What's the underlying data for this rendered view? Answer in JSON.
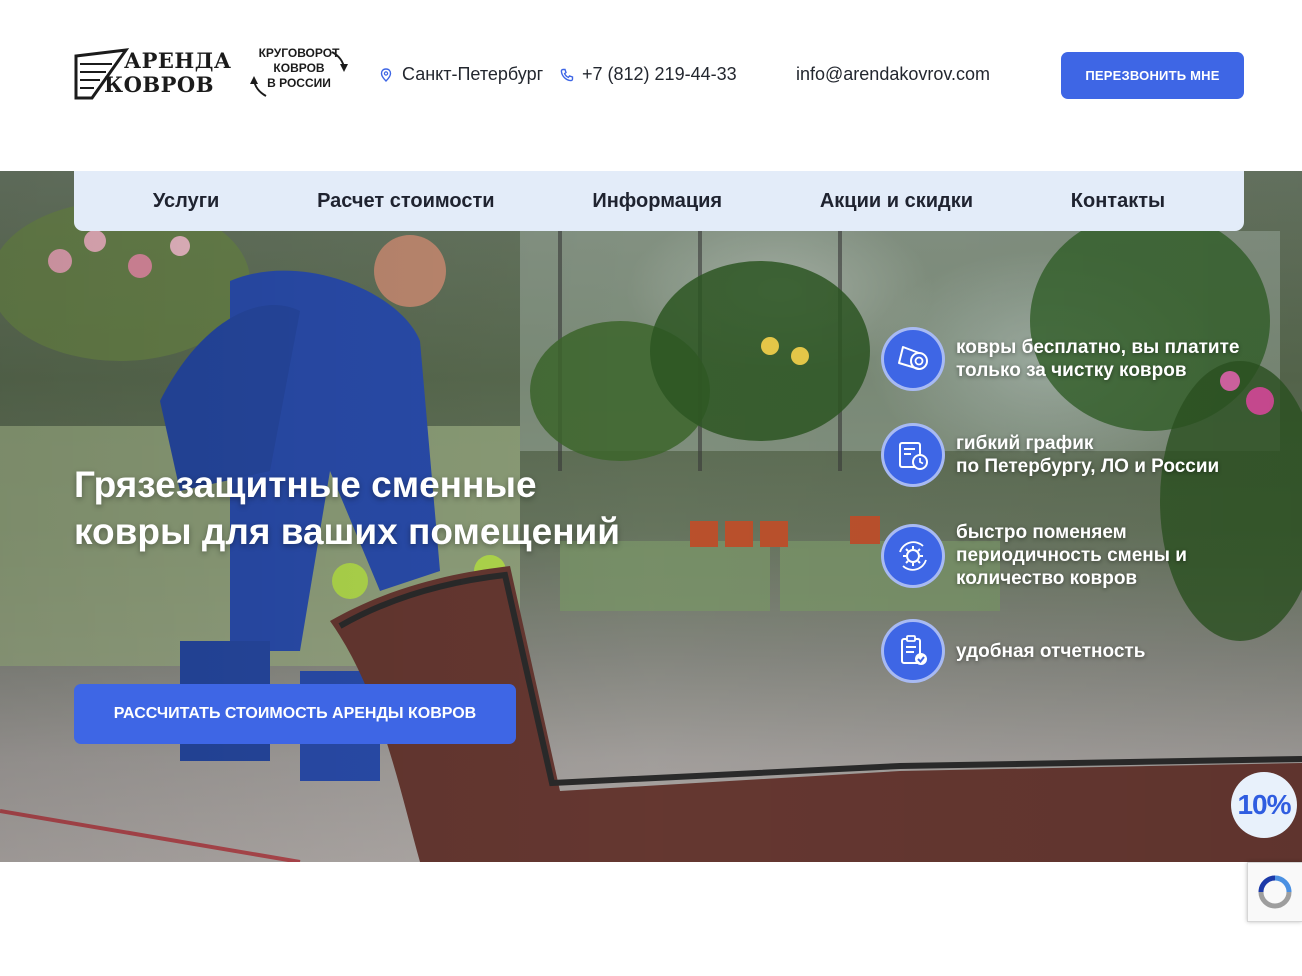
{
  "logo": {
    "line1": "АРЕНДА",
    "line2": "КОВРОВ"
  },
  "slogan": {
    "line1": "КРУГОВОРОТ",
    "line2": "КОВРОВ",
    "line3": "В РОССИИ"
  },
  "header": {
    "city": "Санкт-Петербург",
    "phone": "+7 (812) 219-44-33",
    "email": "info@arendakovrov.com",
    "callback_label": "ПЕРЕЗВОНИТЬ МНЕ"
  },
  "nav": {
    "items": [
      {
        "label": "Услуги"
      },
      {
        "label": "Расчет стоимости"
      },
      {
        "label": "Информация"
      },
      {
        "label": "Акции и скидки"
      },
      {
        "label": "Контакты"
      }
    ]
  },
  "hero": {
    "title_line1": "Грязезащитные сменные",
    "title_line2": "ковры для ваших помещений",
    "cta_label": "РАССЧИТАТЬ СТОИМОСТЬ АРЕНДЫ КОВРОВ"
  },
  "features": [
    {
      "icon": "carpet-roll-icon",
      "lines": [
        "ковры бесплатно, вы платите",
        "только за чистку ковров"
      ]
    },
    {
      "icon": "schedule-icon",
      "lines": [
        "гибкий график",
        "по Петербургу, ЛО и России"
      ]
    },
    {
      "icon": "refresh-gear-icon",
      "lines": [
        "быстро поменяем",
        "периодичность смены и",
        "количество ковров"
      ]
    },
    {
      "icon": "report-clipboard-icon",
      "lines": [
        "удобная отчетность"
      ]
    }
  ],
  "promo_badge": "10%",
  "colors": {
    "accent": "#3e66e5",
    "nav_bg": "#e3ecf9",
    "text": "#1f2330"
  }
}
